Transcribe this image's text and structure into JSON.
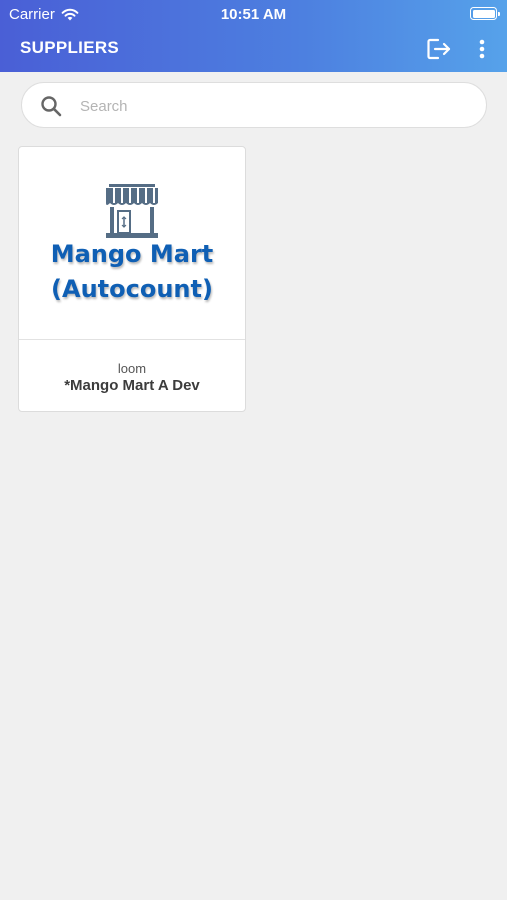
{
  "status_bar": {
    "carrier": "Carrier",
    "time": "10:51 AM",
    "battery_level": 1.0
  },
  "header": {
    "title": "SUPPLIERS",
    "actions": [
      "logout-icon",
      "more-vertical-icon"
    ]
  },
  "search": {
    "placeholder": "Search",
    "value": ""
  },
  "suppliers": [
    {
      "logo_line1": "Mango Mart",
      "logo_line2": "(Autocount)",
      "logo_icon": "storefront-icon",
      "subtitle": "loom",
      "name": "*Mango Mart A Dev"
    }
  ],
  "colors": {
    "header_gradient_start": "#4a5fd6",
    "header_gradient_end": "#56a2ea",
    "logo_text": "#0f5fb4",
    "background": "#f0f0f0"
  }
}
